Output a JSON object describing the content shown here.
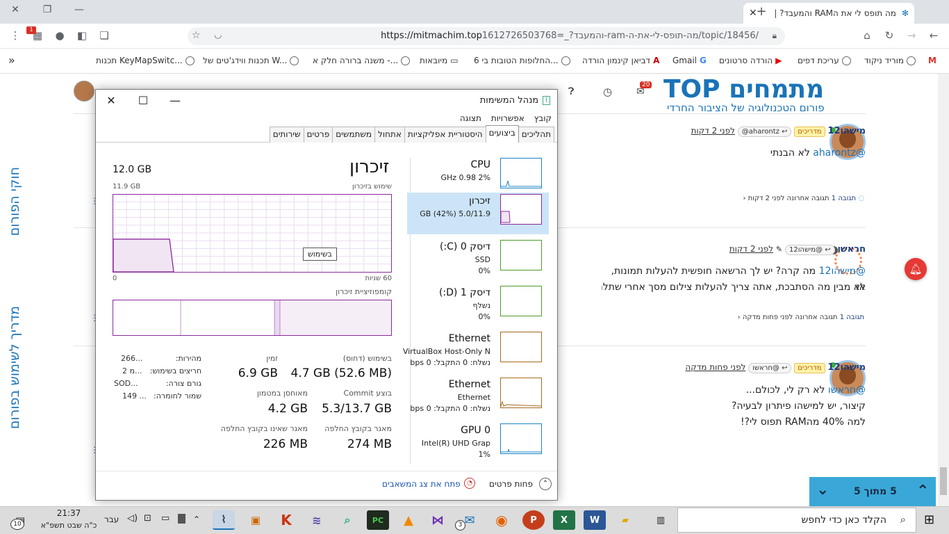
{
  "browser": {
    "tab_title": "מה תופס לי את הRAM והמעבד? |",
    "url_host": "https://mitmachim.top",
    "url_path": "/topic/18456/מה-תופס-לי-את-ה-ram-והמעבד?_=1612726503768",
    "bookmarks": [
      "מוריד ניקוד",
      "עריכת דפים",
      "הורדה סרטונים",
      "Gmail",
      "דביאן קינמון הורדה",
      "6 החלופות הטובות בי...",
      "מיובאות",
      "משנה ברורה חלק א -...",
      "תכנות ווידג'טים של W...",
      "תכנות KeyMapSwitc..."
    ],
    "notification_count": "20",
    "small_badge": "1"
  },
  "forum": {
    "brand": "מתמחים TOP",
    "tagline": "פורום הטכנולוגיה של הציבור החרדי",
    "sidebar_top": "חוקי הפורום",
    "sidebar_bottom": "מדריך לשימוש בפורום",
    "posts": [
      {
        "user": "מישהו12",
        "badge": "מדריכים",
        "reply_to": "aharontz@",
        "time": "לפני 2 דקות",
        "mention": "@aharontz",
        "text": " לא הבנתי",
        "replies": "תגובה 1",
        "last_reply": "תגובה אחרונה לפני 2 דקות"
      },
      {
        "user": "חראשו",
        "badge": "",
        "reply_to": "@מישהו12",
        "time": "לפני 2 דקות",
        "mention": "@מישהו12",
        "text": " מה קרה? יש לך הרשאה חופשית להעלות תמונות, אז",
        "text2": "לא מבין מה הסתבכת, אתה צריך להעלות צילום מסך אחרי שתלח",
        "replies": "תגובה 1",
        "last_reply": "תגובה אחרונה לפני פחות מדקה"
      },
      {
        "user": "מישהו12",
        "badge": "מדריכים",
        "reply_to": "@חראשו",
        "time": "לפני פחות מדקה",
        "mention": "@חראשו",
        "text": " לא רק לי, לכולם...",
        "text2": "קיצור, יש למישהו פיתרון לבעיה?",
        "text3": "למה 40% מהRAM תפוס לי?!"
      }
    ],
    "unread_label": "5 מתוך 5"
  },
  "taskmgr": {
    "title": "מנהל המשימות",
    "menu": [
      "קובץ",
      "אפשרויות",
      "תצוגה"
    ],
    "tabs": [
      "תהליכים",
      "ביצועים",
      "היסטוריית אפליקציות",
      "אתחול",
      "משתמשים",
      "פרטים",
      "שירותים"
    ],
    "active_tab": "ביצועים",
    "tiles": [
      {
        "name": "CPU",
        "sub1": "2%  0.98 GHz",
        "sub2": "",
        "color": "#1a83c6"
      },
      {
        "name": "זיכרון",
        "sub1": "5.0/11.9 GB (42%)",
        "sub2": "",
        "color": "#8b2a9e"
      },
      {
        "name": "דיסק 0 (C:)",
        "sub1": "SSD",
        "sub2": "0%",
        "color": "#4e9a29"
      },
      {
        "name": "דיסק 1 (D:)",
        "sub1": "נשלף",
        "sub2": "0%",
        "color": "#4e9a29"
      },
      {
        "name": "Ethernet",
        "sub1": "VirtualBox Host-Only N",
        "sub2": "נשלח: 0 התקבל: 0 bps",
        "color": "#a76a1e"
      },
      {
        "name": "Ethernet",
        "sub1": "Ethernet",
        "sub2": "נשלח: 0 התקבל: 0 bps",
        "color": "#a76a1e"
      },
      {
        "name": "GPU 0",
        "sub1": "Intel(R) UHD Grap",
        "sub2": "1%",
        "color": "#1a83c6"
      }
    ],
    "detail": {
      "heading": "זיכרון",
      "total": "12.0 GB",
      "usage_label": "שימוש בזיכרון",
      "usage_max": "11.9 GB",
      "axis_left": "60 שניות",
      "axis_right": "0",
      "tooltip": "בשימוש",
      "composition_label": "קומפוזיציית זיכרון",
      "in_use_label": "בשימוש (דחוס)",
      "in_use_value": "4.7 GB (52.6 MB)",
      "available_label": "זמין",
      "available_value": "6.9 GB",
      "committed_label": "בוצע Commit",
      "committed_value": "5.3/13.7 GB",
      "cached_label": "מאוחסן במטמון",
      "cached_value": "4.2 GB",
      "paged_label": "מאגר בקובץ החלפה",
      "paged_value": "274 MB",
      "nonpaged_label": "מאגר שאינו בקובץ החלפה",
      "nonpaged_value": "226 MB",
      "speed_label": "מהירות:",
      "speed_value": "266...",
      "slots_label": "חריצים בשימוש:",
      "slots_value": "2 מ...",
      "form_label": "גורם צורה:",
      "form_value": "SOD...",
      "reserved_label": "שמור לחומרה:",
      "reserved_value": "149 ..."
    },
    "footer_less": "פחות פרטים",
    "footer_monitor": "פתח את צג המשאבים",
    "memory_usage_fraction": 0.42
  },
  "taskbar": {
    "search_placeholder": "הקלד כאן כדי לחפש",
    "time": "21:37",
    "date": "כ\"ה שבט תשפ\"א",
    "lang": "עבר",
    "notif_count": "10",
    "mail_count": "3"
  }
}
